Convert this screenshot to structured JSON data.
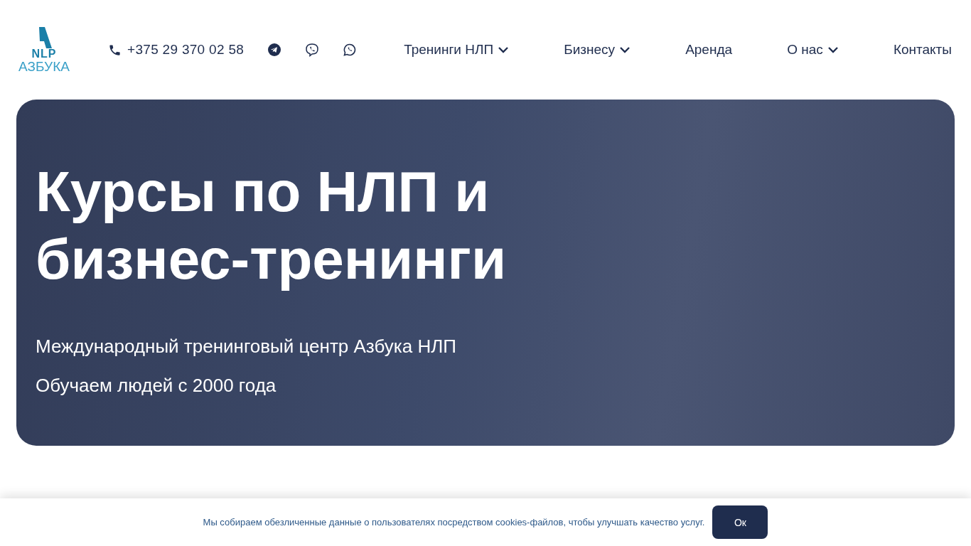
{
  "logo": {
    "mark": "NLP",
    "name": "АЗБУКА"
  },
  "phone": "+375 29 370 02 58",
  "messengers": [
    {
      "kind": "telegram"
    },
    {
      "kind": "viber"
    },
    {
      "kind": "whatsapp"
    }
  ],
  "nav": [
    {
      "label": "Тренинги НЛП",
      "has_menu": true
    },
    {
      "label": "Бизнесу",
      "has_menu": true
    },
    {
      "label": "Аренда",
      "has_menu": false
    },
    {
      "label": "О нас",
      "has_menu": true
    },
    {
      "label": "Контакты",
      "has_menu": false
    }
  ],
  "hero": {
    "title": "Курсы по НЛП и бизнес-тренинги",
    "lines": [
      "Международный тренинговый центр Азбука НЛП",
      "Обучаем людей с 2000 года"
    ]
  },
  "cookie": {
    "text": "Мы собираем обезличенные данные о пользователях посредством cookies-файлов, чтобы улучшать качество услуг.",
    "button": "Ок"
  }
}
